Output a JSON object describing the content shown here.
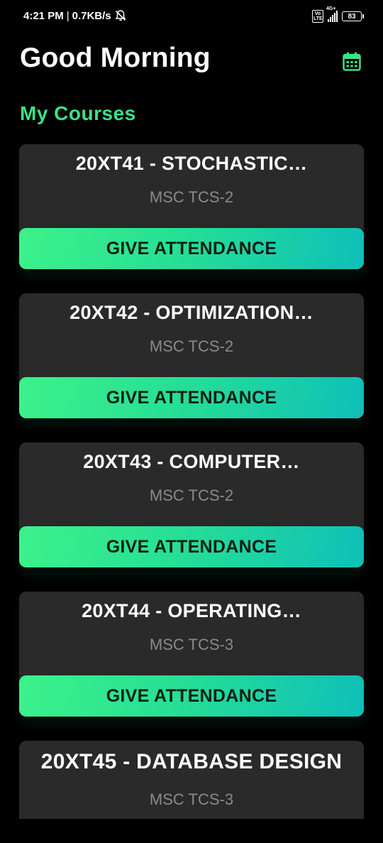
{
  "status_bar": {
    "time": "4:21 PM",
    "separator": "|",
    "speed": "0.7KB/s",
    "volte_label": "Vo LTE",
    "network_label": "4G+",
    "battery": "83"
  },
  "header": {
    "greeting": "Good Morning",
    "calendar_icon": "calendar-icon",
    "accent_color": "#3de184"
  },
  "section": {
    "title": "My Courses"
  },
  "courses": [
    {
      "title": "20XT41 - STOCHASTIC…",
      "class": "MSC TCS-2",
      "action": "GIVE ATTENDANCE"
    },
    {
      "title": "20XT42 - OPTIMIZATION…",
      "class": "MSC TCS-2",
      "action": "GIVE ATTENDANCE"
    },
    {
      "title": "20XT43 - COMPUTER…",
      "class": "MSC TCS-2",
      "action": "GIVE ATTENDANCE"
    },
    {
      "title": "20XT44 - OPERATING…",
      "class": "MSC TCS-3",
      "action": "GIVE ATTENDANCE"
    },
    {
      "title": "20XT45 - DATABASE DESIGN",
      "class": "MSC TCS-3"
    }
  ],
  "colors": {
    "background": "#000000",
    "card": "#2a2a2a",
    "button_gradient_start": "#3cf28a",
    "button_gradient_end": "#0ec0b8",
    "subtitle": "#8a8a8a"
  }
}
